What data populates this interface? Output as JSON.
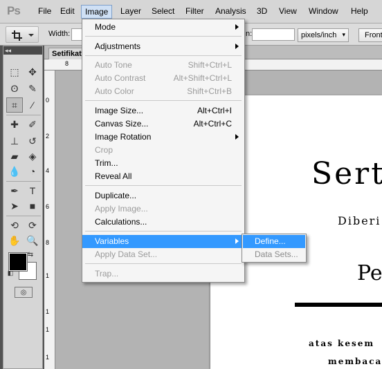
{
  "app": {
    "logo": "Ps"
  },
  "menubar": {
    "items": [
      "File",
      "Edit",
      "Image",
      "Layer",
      "Select",
      "Filter",
      "Analysis",
      "3D",
      "View",
      "Window",
      "Help"
    ],
    "active": "Image"
  },
  "options_bar": {
    "width_label": "Width:",
    "height_label_fragment": "n:",
    "units_select": "pixels/inch",
    "front_button": "Front"
  },
  "document": {
    "tab_label": "Setifikat.",
    "ruler_top": [
      "8"
    ],
    "ruler_left": [
      "0",
      "2",
      "4",
      "6",
      "8",
      "1",
      "1",
      "1",
      "1"
    ],
    "title": "Sert",
    "sub1": "Diberi",
    "name": "Pe",
    "sub2": "atas kesem",
    "sub3": "membaca"
  },
  "image_menu": {
    "items": [
      {
        "label": "Mode",
        "shortcut": "",
        "submenu": true,
        "disabled": false
      },
      {
        "label": "Adjustments",
        "shortcut": "",
        "submenu": true,
        "disabled": false
      },
      {
        "label": "Auto Tone",
        "shortcut": "Shift+Ctrl+L",
        "submenu": false,
        "disabled": true
      },
      {
        "label": "Auto Contrast",
        "shortcut": "Alt+Shift+Ctrl+L",
        "submenu": false,
        "disabled": true
      },
      {
        "label": "Auto Color",
        "shortcut": "Shift+Ctrl+B",
        "submenu": false,
        "disabled": true
      },
      {
        "label": "Image Size...",
        "shortcut": "Alt+Ctrl+I",
        "submenu": false,
        "disabled": false
      },
      {
        "label": "Canvas Size...",
        "shortcut": "Alt+Ctrl+C",
        "submenu": false,
        "disabled": false
      },
      {
        "label": "Image Rotation",
        "shortcut": "",
        "submenu": true,
        "disabled": false
      },
      {
        "label": "Crop",
        "shortcut": "",
        "submenu": false,
        "disabled": true
      },
      {
        "label": "Trim...",
        "shortcut": "",
        "submenu": false,
        "disabled": false
      },
      {
        "label": "Reveal All",
        "shortcut": "",
        "submenu": false,
        "disabled": false
      },
      {
        "label": "Duplicate...",
        "shortcut": "",
        "submenu": false,
        "disabled": false
      },
      {
        "label": "Apply Image...",
        "shortcut": "",
        "submenu": false,
        "disabled": true
      },
      {
        "label": "Calculations...",
        "shortcut": "",
        "submenu": false,
        "disabled": false
      },
      {
        "label": "Variables",
        "shortcut": "",
        "submenu": true,
        "disabled": false,
        "highlighted": true
      },
      {
        "label": "Apply Data Set...",
        "shortcut": "",
        "submenu": false,
        "disabled": true
      },
      {
        "label": "Trap...",
        "shortcut": "",
        "submenu": false,
        "disabled": true
      }
    ]
  },
  "variables_submenu": {
    "items": [
      {
        "label": "Define...",
        "highlighted": true,
        "disabled": false
      },
      {
        "label": "Data Sets...",
        "highlighted": false,
        "disabled": true
      }
    ]
  },
  "colors": {
    "highlight": "#3399ff",
    "disabled_text": "#9a9a9a",
    "menu_bg": "#f5f5f5"
  }
}
